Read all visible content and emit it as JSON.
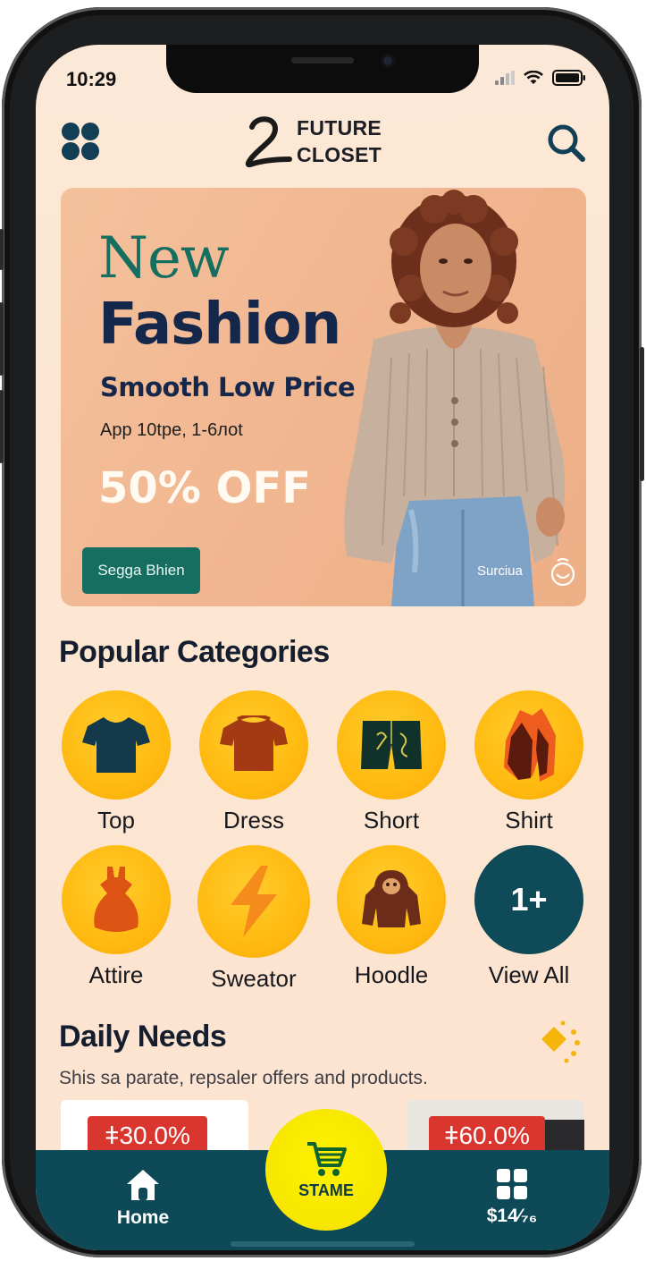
{
  "status_bar": {
    "time": "10:29"
  },
  "header": {
    "logo_line1": "FUTURE",
    "logo_line2": "CLOSET",
    "menu_icon": "grid-icon",
    "search_icon": "search-icon"
  },
  "banner": {
    "title_line1": "New",
    "title_line2": "Fashion",
    "subtitle": "Smooth Low Price",
    "detail": "App 10tpe, 1-6лоt",
    "discount": "50% OFF",
    "cta_label": "Segga Bhien",
    "corner_text": "Surciua",
    "colors": {
      "title_green": "#166e61",
      "title_navy": "#15274a",
      "cta_bg": "#166e61"
    }
  },
  "categories": {
    "title": "Popular Categories",
    "items": [
      {
        "label": "Top",
        "icon": "tshirt-icon"
      },
      {
        "label": "Dress",
        "icon": "dress-top-icon"
      },
      {
        "label": "Short",
        "icon": "shorts-icon"
      },
      {
        "label": "Shirt",
        "icon": "shirt-icon"
      },
      {
        "label": "Attire",
        "icon": "attire-icon"
      },
      {
        "label": "Sweator",
        "icon": "sweater-icon"
      },
      {
        "label": "Hoodle",
        "icon": "hoodie-icon"
      },
      {
        "label": "View All",
        "icon": "view-all-icon",
        "badge": "1+"
      }
    ]
  },
  "daily_needs": {
    "title": "Daily Needs",
    "subtitle": "Shis sa parate, repsaler offers and products.",
    "badges": [
      "ǂ30.0%",
      "ǂ60.0%"
    ]
  },
  "bottom_nav": {
    "home_label": "Home",
    "center_label": "STAME",
    "right_label": "$14⁄₇₆",
    "colors": {
      "bar": "#0d4957",
      "fab": "#f7e600"
    }
  }
}
